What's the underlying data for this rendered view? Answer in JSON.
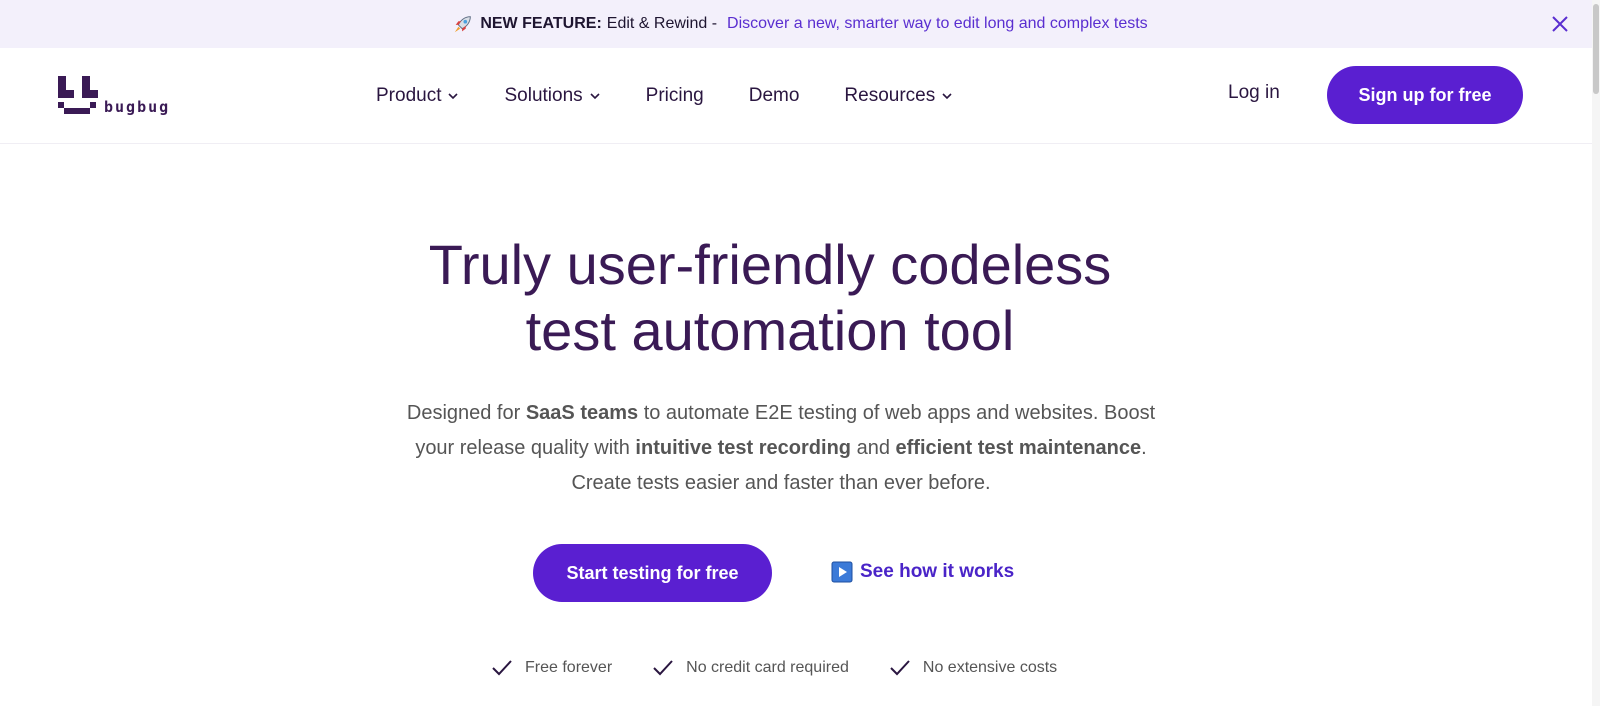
{
  "announcement": {
    "label": "NEW FEATURE:",
    "text": "Edit & Rewind -",
    "link": "Discover a new, smarter way to edit long and complex tests",
    "icon": "rocket-icon"
  },
  "nav": {
    "logo_text": "bugbug",
    "items": [
      {
        "label": "Product",
        "dropdown": true
      },
      {
        "label": "Solutions",
        "dropdown": true
      },
      {
        "label": "Pricing",
        "dropdown": false
      },
      {
        "label": "Demo",
        "dropdown": false
      },
      {
        "label": "Resources",
        "dropdown": true
      }
    ],
    "login": "Log in",
    "signup": "Sign up for free"
  },
  "hero": {
    "title_line1": "Truly user-friendly codeless",
    "title_line2": "test automation tool",
    "sub": {
      "p1": "Designed for ",
      "b1": "SaaS teams",
      "p2": " to automate E2E testing of web apps and websites. Boost your release quality with ",
      "b2": "intuitive test recording",
      "p3": " and ",
      "b3": "efficient test maintenance",
      "p4": ". Create tests easier and faster than ever before."
    },
    "cta": "Start testing for free",
    "how": "See how it works",
    "checks": [
      "Free forever",
      "No credit card required",
      "No extensive costs"
    ]
  },
  "colors": {
    "brand": "#5a1fd1",
    "heading": "#3a1a55",
    "banner_bg": "#f3f0fb"
  }
}
